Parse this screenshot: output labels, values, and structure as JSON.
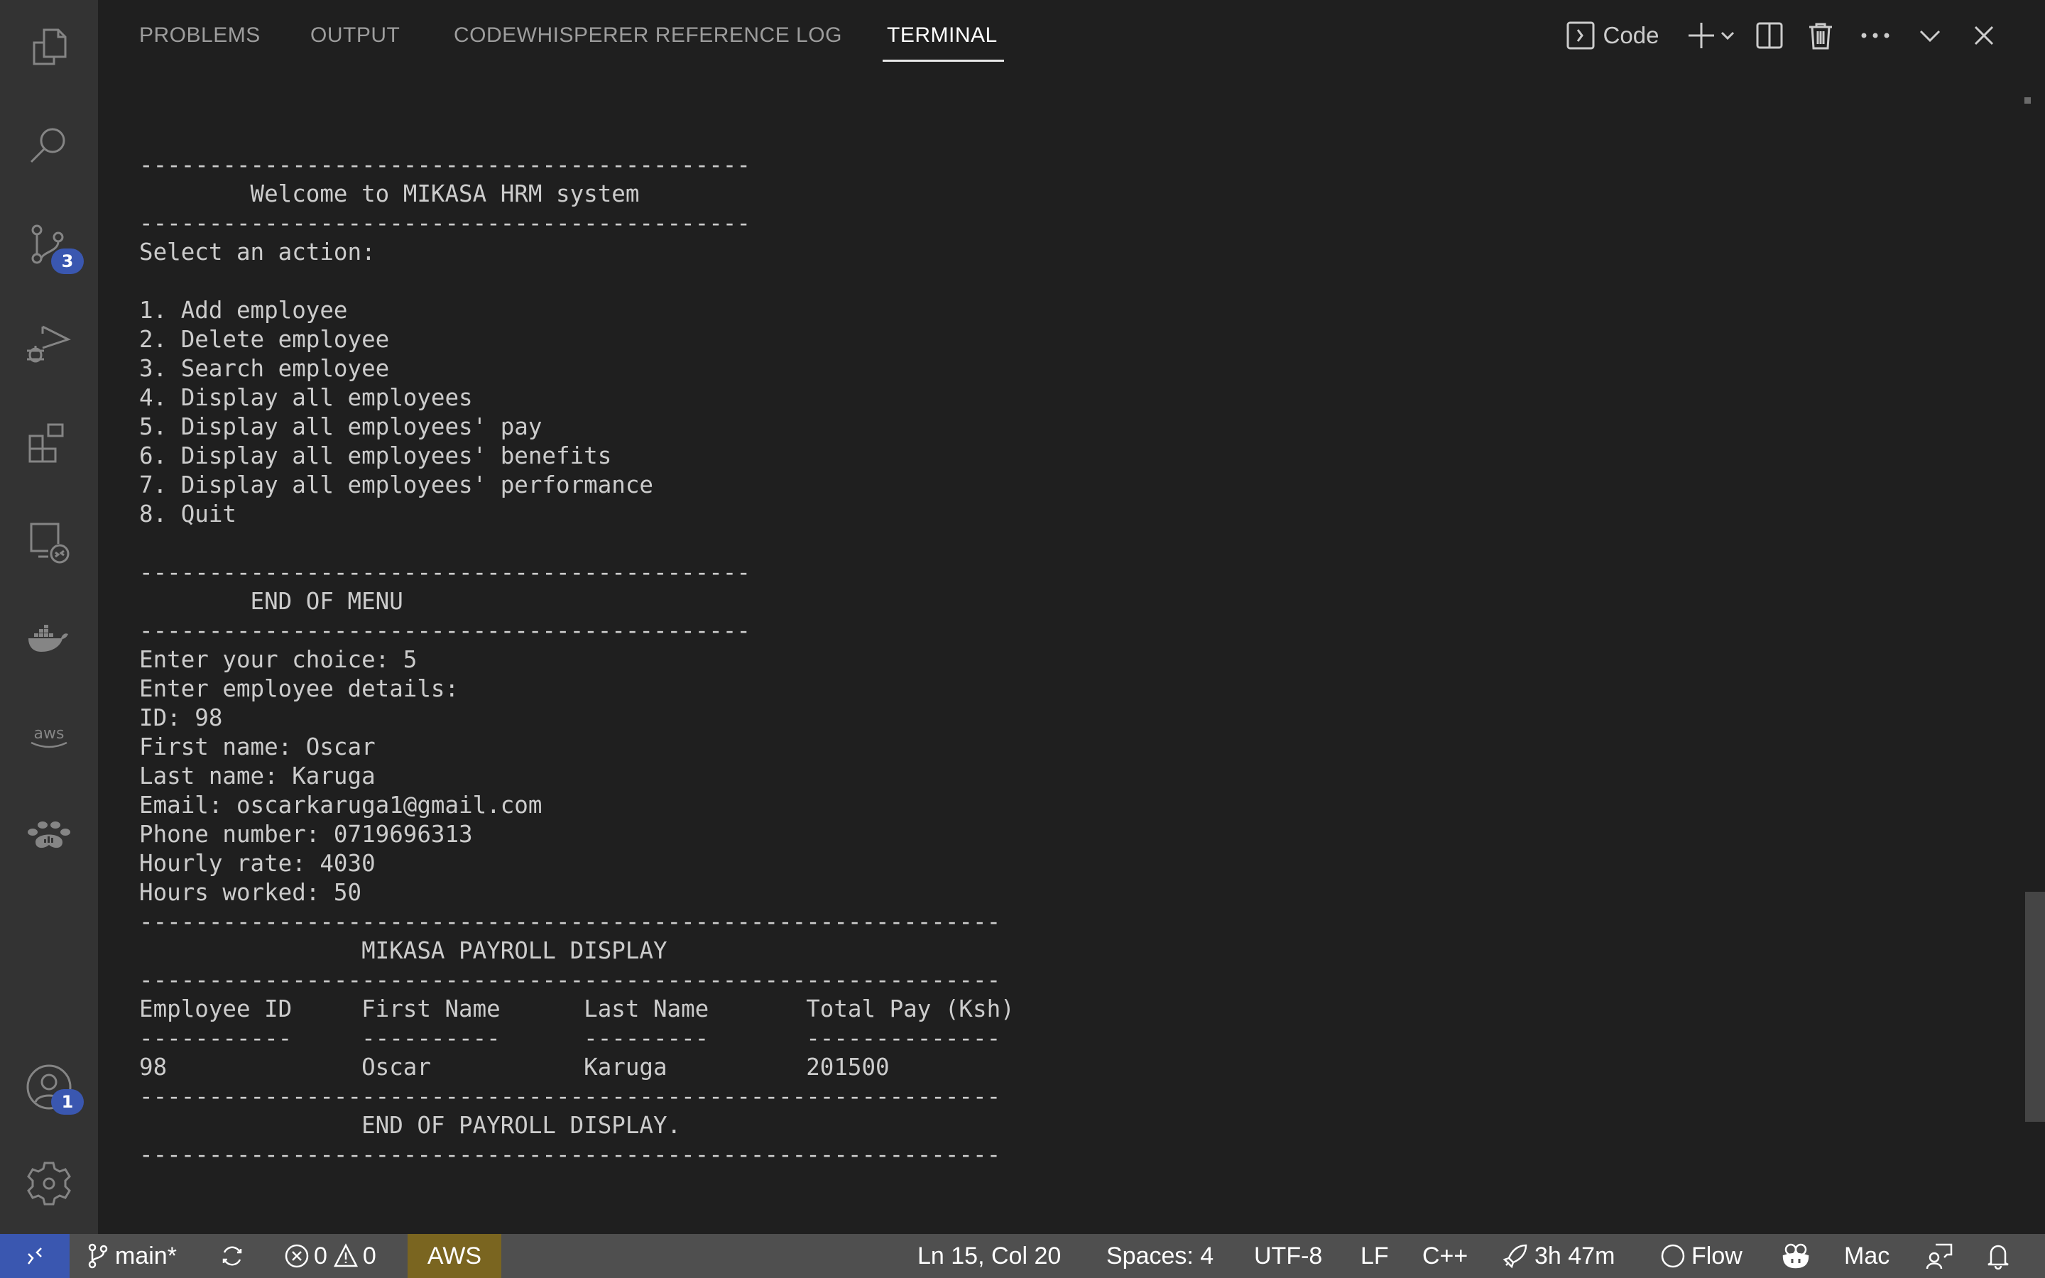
{
  "activity_bar": {
    "items": [
      {
        "name": "explorer",
        "icon": "files-icon"
      },
      {
        "name": "search",
        "icon": "search-icon"
      },
      {
        "name": "source-control",
        "icon": "source-control-icon",
        "badge": "3"
      },
      {
        "name": "run-and-debug",
        "icon": "run-debug-icon"
      },
      {
        "name": "extensions",
        "icon": "extensions-icon"
      },
      {
        "name": "remote-explorer",
        "icon": "remote-explorer-icon"
      },
      {
        "name": "docker",
        "icon": "docker-icon"
      },
      {
        "name": "aws",
        "icon": "aws-icon"
      },
      {
        "name": "datadog",
        "icon": "paw-icon"
      }
    ],
    "bottom": [
      {
        "name": "accounts",
        "icon": "account-icon",
        "badge": "1"
      },
      {
        "name": "manage",
        "icon": "gear-icon"
      }
    ]
  },
  "panel": {
    "tabs": [
      {
        "label": "PROBLEMS",
        "active": false
      },
      {
        "label": "OUTPUT",
        "active": false
      },
      {
        "label": "CODEWHISPERER REFERENCE LOG",
        "active": false
      },
      {
        "label": "TERMINAL",
        "active": true
      }
    ],
    "actions": {
      "terminal_profile_label": "Code",
      "icons": [
        "terminal-icon",
        "plus-icon",
        "chevron-down-icon",
        "split-icon",
        "trash-icon",
        "ellipsis-icon",
        "chevron-down-icon",
        "close-icon"
      ]
    }
  },
  "terminal": {
    "lines": [
      "--------------------------------------------",
      "        Welcome to MIKASA HRM system",
      "--------------------------------------------",
      "Select an action:",
      "",
      "1. Add employee",
      "2. Delete employee",
      "3. Search employee",
      "4. Display all employees",
      "5. Display all employees' pay",
      "6. Display all employees' benefits",
      "7. Display all employees' performance",
      "8. Quit",
      "",
      "--------------------------------------------",
      "        END OF MENU",
      "--------------------------------------------",
      "Enter your choice: 5",
      "Enter employee details:",
      "ID: 98",
      "First name: Oscar",
      "Last name: Karuga",
      "Email: oscarkaruga1@gmail.com",
      "Phone number: 0719696313",
      "Hourly rate: 4030",
      "Hours worked: 50",
      "--------------------------------------------------------------",
      "                MIKASA PAYROLL DISPLAY",
      "--------------------------------------------------------------",
      "Employee ID     First Name      Last Name       Total Pay (Ksh)",
      "-----------     ----------      ---------       --------------",
      "98              Oscar           Karuga          201500",
      "--------------------------------------------------------------",
      "                END OF PAYROLL DISPLAY.",
      "--------------------------------------------------------------"
    ]
  },
  "statusbar": {
    "branch": "main*",
    "errors": "0",
    "warnings": "0",
    "aws": "AWS",
    "position": "Ln 15, Col 20",
    "spaces": "Spaces: 4",
    "encoding": "UTF-8",
    "eol": "LF",
    "language": "C++",
    "time_tracked": "3h 47m",
    "flow": "Flow",
    "keyboard": "Mac",
    "colors": {
      "remote": "#3a57b0",
      "aws": "#7a6520",
      "bar": "#4f4f4f"
    }
  }
}
